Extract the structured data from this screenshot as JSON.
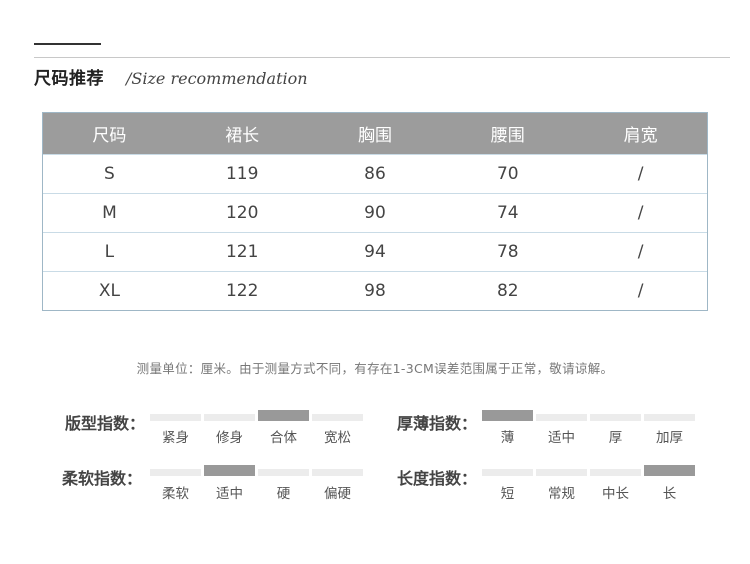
{
  "header": {
    "title_cn": "尺码推荐",
    "title_en": "/Size recommendation"
  },
  "table": {
    "headers": [
      "尺码",
      "裙长",
      "胸围",
      "腰围",
      "肩宽"
    ],
    "rows": [
      [
        "S",
        "119",
        "86",
        "70",
        "/"
      ],
      [
        "M",
        "120",
        "90",
        "74",
        "/"
      ],
      [
        "L",
        "121",
        "94",
        "78",
        "/"
      ],
      [
        "XL",
        "122",
        "98",
        "82",
        "/"
      ]
    ]
  },
  "note": "测量单位：厘米。由于测量方式不同，有存在1-3CM误差范围属于正常，敬请谅解。",
  "indices": {
    "fit": {
      "label": "版型指数：",
      "options": [
        "紧身",
        "修身",
        "合体",
        "宽松"
      ],
      "selected": 2
    },
    "thickness": {
      "label": "厚薄指数：",
      "options": [
        "薄",
        "适中",
        "厚",
        "加厚"
      ],
      "selected": 0
    },
    "softness": {
      "label": "柔软指数：",
      "options": [
        "柔软",
        "适中",
        "硬",
        "偏硬"
      ],
      "selected": 1
    },
    "length": {
      "label": "长度指数：",
      "options": [
        "短",
        "常规",
        "中长",
        "长"
      ],
      "selected": 3
    }
  },
  "colors": {
    "header_bg": "#9c9c9c",
    "table_border": "#9fb7c6",
    "active_segment": "#999999",
    "inactive_segment": "#ececec"
  }
}
